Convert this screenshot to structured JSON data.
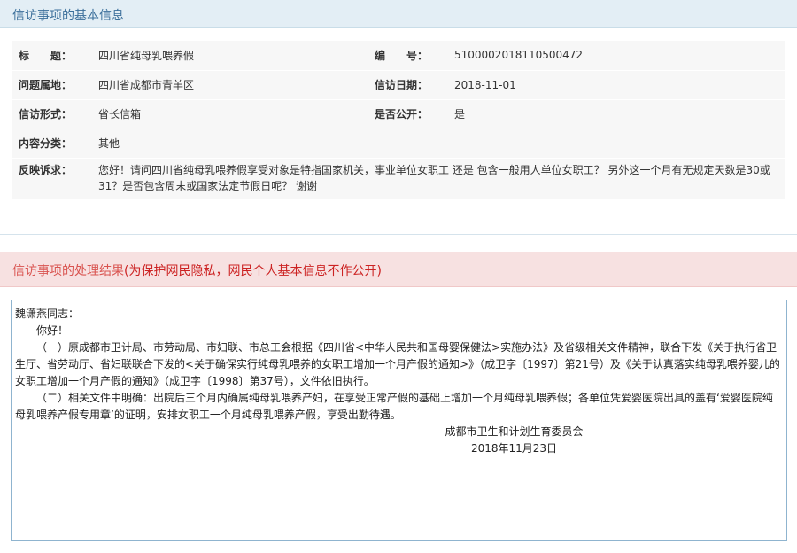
{
  "basic_section": {
    "title": "信访事项的基本信息"
  },
  "info": {
    "title_label": "标　　题：",
    "title_value": "四川省纯母乳喂养假",
    "number_label": "编　　号：",
    "number_value": "5100002018110500472",
    "location_label": "问题属地：",
    "location_value": "四川省成都市青羊区",
    "date_label": "信访日期：",
    "date_value": "2018-11-01",
    "form_label": "信访形式：",
    "form_value": "省长信箱",
    "public_label": "是否公开：",
    "public_value": "是",
    "category_label": "内容分类：",
    "category_value": "其他",
    "appeal_label": "反映诉求：",
    "appeal_value": "您好！请问四川省纯母乳喂养假享受对象是特指国家机关，事业单位女职工 还是 包含一般用人单位女职工？ 另外这一个月有无规定天数是30或31？是否包含周末或国家法定节假日呢？ 谢谢"
  },
  "result_section": {
    "title": "信访事项的处理结果",
    "note": "(为保护网民隐私，网民个人基本信息不作公开)"
  },
  "reply": {
    "salutation": "魏潇燕同志：",
    "greeting": "你好！",
    "para1": "（一）原成都市卫计局、市劳动局、市妇联、市总工会根据《四川省<中华人民共和国母婴保健法>实施办法》及省级相关文件精神，联合下发《关于执行省卫生厅、省劳动厅、省妇联联合下发的<关于确保实行纯母乳喂养的女职工增加一个月产假的通知>》（成卫字〔1997〕第21号）及《关于认真落实纯母乳喂养婴儿的女职工增加一个月产假的通知》（成卫字〔1998〕第37号），文件依旧执行。",
    "para2": "（二）相关文件中明确：出院后三个月内确属纯母乳喂养产妇，在享受正常产假的基础上增加一个月纯母乳喂养假；各单位凭爱婴医院出具的盖有‘爱婴医院纯母乳喂养产假专用章’的证明，安排女职工一个月纯母乳喂养产假，享受出勤待遇。",
    "sign_org": "成都市卫生和计划生育委员会",
    "sign_date": "2018年11月23日"
  }
}
